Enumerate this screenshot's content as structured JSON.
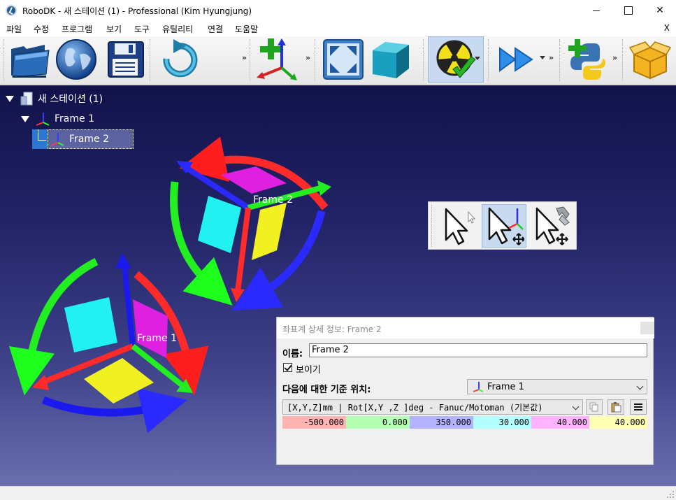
{
  "window": {
    "title": "RoboDK - 새 스테이션 (1) - Professional (Kim Hyungjung)",
    "minimize_icon": "minimize-icon",
    "maximize_icon": "maximize-icon",
    "close_glyph": "✕"
  },
  "menu": {
    "items": [
      "파일",
      "수정",
      "프로그램",
      "보기",
      "도구",
      "유틸리티",
      "연결",
      "도움말"
    ],
    "close_label": "X"
  },
  "toolbar": {
    "buttons": [
      "open-folder-icon",
      "online-library-globe-icon",
      "save-floppy-icon",
      "undo-icon",
      "add-reference-frame-icon",
      "fit-all-icon",
      "isometric-view-icon",
      "collision-check-icon",
      "run-program-icon",
      "add-python-program-icon",
      "add-package-icon"
    ],
    "overflow_glyph": "»"
  },
  "tree": {
    "station": "새 스테이션 (1)",
    "frame1": "Frame 1",
    "frame2": "Frame 2"
  },
  "scene": {
    "frame2_label": "Frame 2",
    "frame1_label": "Frame 1"
  },
  "floating_toolbar": {
    "buttons": [
      "select-cursor-icon",
      "move-reference-frame-icon",
      "move-tool-icon"
    ],
    "active": "move-reference-frame-icon"
  },
  "dialog": {
    "title": "좌표계 상세 정보: Frame 2",
    "name_label": "이름:",
    "name_value": "Frame 2",
    "visible_label": "보이기",
    "visible_checked": true,
    "reference_label": "다음에 대한 기준 위치:",
    "reference_value": "Frame 1",
    "format_value": "[X,Y,Z]mm | Rot[X,Y ,Z  ]deg - Fanuc/Motoman (기본값)",
    "pose_values": [
      "-500.000",
      "0.000",
      "350.000",
      "30.000",
      "40.000",
      "40.000"
    ],
    "pose_colors": [
      "#ffb3b3",
      "#b3ffb3",
      "#b3b3ff",
      "#b3ffff",
      "#ffb3ff",
      "#ffffb3"
    ],
    "buttons": [
      "copy-icon",
      "paste-icon",
      "menu-icon"
    ]
  }
}
